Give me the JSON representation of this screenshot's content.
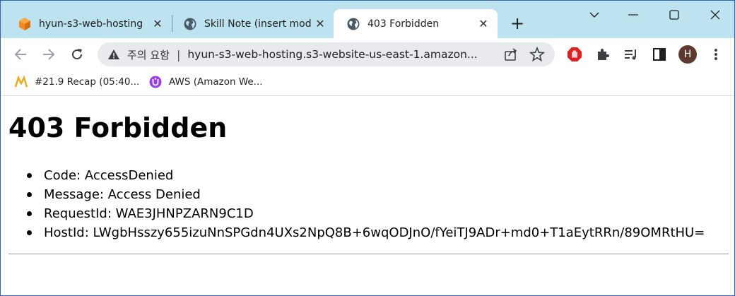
{
  "tabs": [
    {
      "title": "hyun-s3-web-hosting",
      "favicon": "aws-cube-icon",
      "active": false
    },
    {
      "title": "Skill Note (insert mod",
      "favicon": "globe-icon",
      "active": false
    },
    {
      "title": "403 Forbidden",
      "favicon": "globe-icon",
      "active": true
    }
  ],
  "new_tab_label": "+",
  "address_bar": {
    "security_label": "주의 요함",
    "separator": "|",
    "url": "hyun-s3-web-hosting.s3-website-us-east-1.amazon..."
  },
  "profile_initial": "H",
  "bookmarks": [
    {
      "label": "#21.9 Recap (05:40...",
      "icon": "m-logo-icon"
    },
    {
      "label": "AWS (Amazon We...",
      "icon": "purple-u-icon"
    }
  ],
  "page": {
    "heading": "403 Forbidden",
    "items": [
      "Code: AccessDenied",
      "Message: Access Denied",
      "RequestId: WAE3JHNPZARN9C1D",
      "HostId: LWgbHsszy655izuNnSPGdn4UXs2NpQ8B+6wqODJnO/fYeiTJ9ADr+md0+T1aEytRRn/89OMRtHU="
    ]
  },
  "colors": {
    "tabstrip": "#bde3f1",
    "omnibox": "#e8eaed",
    "window_border": "#2f62b8"
  }
}
